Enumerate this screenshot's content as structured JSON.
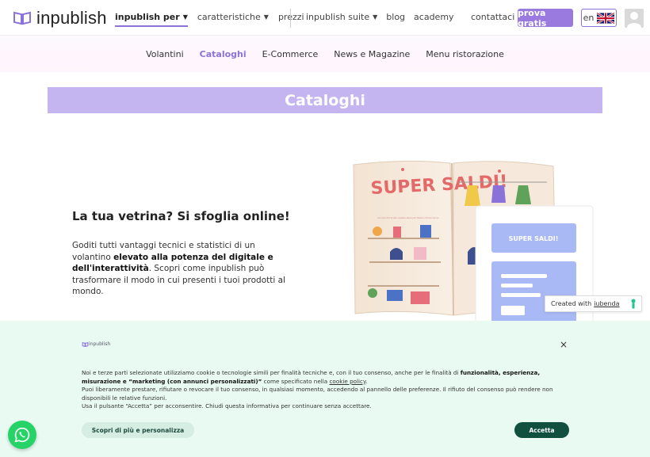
{
  "header": {
    "logo_text": "inpublish",
    "nav": [
      {
        "label": "inpublish per",
        "caret": true,
        "active": true
      },
      {
        "label": "caratteristiche",
        "caret": true,
        "active": false
      },
      {
        "label": "prezzi",
        "caret": false,
        "active": false
      }
    ],
    "nav2": [
      {
        "label": "inpublish suite",
        "caret": true
      },
      {
        "label": "blog",
        "caret": false
      },
      {
        "label": "academy",
        "caret": false
      }
    ],
    "contatti": "contattaci",
    "cta": "prova gratis",
    "lang": "en",
    "accent": "#9b7ae0"
  },
  "subnav": {
    "items": [
      "Volantini",
      "Cataloghi",
      "E-Commerce",
      "News e Magazine",
      "Menu ristorazione"
    ],
    "active": "Cataloghi"
  },
  "banner": {
    "title": "Cataloghi",
    "color": "#c4b5f0"
  },
  "hero": {
    "title": "La tua vetrina? Si sfoglia online!",
    "text_1": "Goditi tutti vantaggi tecnici e statistici di un volantino ",
    "text_bold": "elevato alla potenza del digitale e dell'interattività",
    "text_2": ". Scopri come inpublish può trasformare il modo in cui presenti i tuoi prodotti al mondo.",
    "illustration": {
      "page_title": "SUPER SALDI!",
      "page_subtitle": "Lorem ipsum dolor sit amet, consectetur adipiscing elit. Phasellus ut ultricies lorem nec.",
      "card_button": "SUPER SALDI!"
    }
  },
  "iubenda": {
    "prefix": "Created with",
    "link": "iubenda"
  },
  "cookie": {
    "logo": "inpublish",
    "close": "×",
    "text_a": "Noi e terze parti selezionate utilizziamo cookie o tecnologie simili per finalità tecniche e, con il tuo consenso, anche per le finalità di ",
    "text_bold": "funzionalità, esperienza, misurazione e “marketing (con annunci personalizzati)”",
    "text_b": " come specificato nella ",
    "link": "cookie policy",
    "text_c": ".",
    "text_2": "Puoi liberamente prestare, rifiutare o revocare il tuo consenso, in qualsiasi momento, accedendo al pannello delle preferenze. Il rifiuto del consenso può rendere non disponibili le relative funzioni.",
    "text_3": "Usa il pulsante “Accetta” per acconsentire. Chiudi questa informativa per continuare senza accettare.",
    "btn_more": "Scopri di più e personalizza",
    "btn_accept": "Accetta",
    "bg": "#e9faf3",
    "accept_color": "#11503f"
  }
}
